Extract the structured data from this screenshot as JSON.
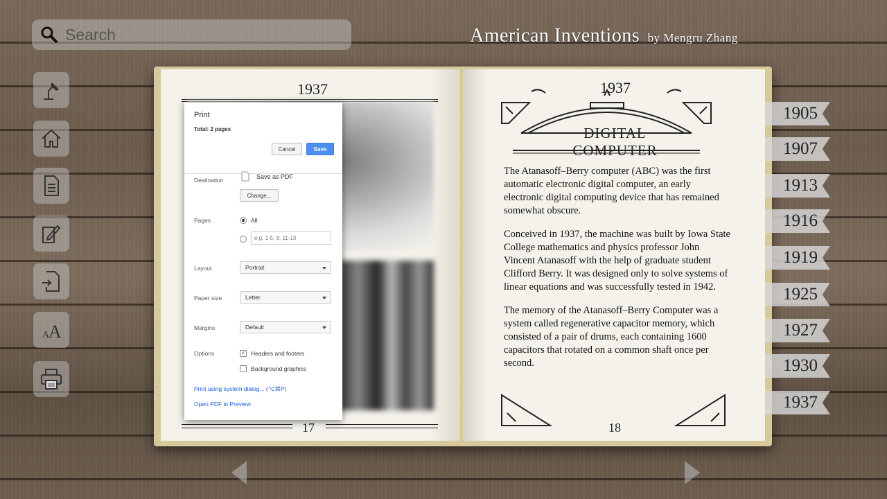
{
  "search": {
    "placeholder": "Search"
  },
  "header": {
    "title": "American Inventions",
    "byline": "by Mengru Zhang"
  },
  "toolbar": [
    "lamp-icon",
    "home-icon",
    "document-icon",
    "edit-note-icon",
    "import-icon",
    "font-size-icon",
    "print-icon"
  ],
  "book": {
    "left": {
      "year": "1937",
      "page_number": "17"
    },
    "right": {
      "year": "1937",
      "heading": "DIGITAL COMPUTER",
      "page_number": "18",
      "paragraphs": [
        "The Atanasoff–Berry computer (ABC) was the first automatic electronic digital computer, an early electronic digital computing device that has remained somewhat obscure.",
        "Conceived in 1937, the machine was built by Iowa State College mathematics and physics professor John Vincent Atanasoff with the help of graduate student Clifford Berry. It was designed only to solve systems of linear equations and was successfully tested in 1942.",
        "The memory of the Atanasoff–Berry Computer was a system called regenerative capacitor memory, which consisted of a pair of drums, each containing 1600 capacitors that rotated on a common shaft once per second."
      ]
    }
  },
  "print_dialog": {
    "title": "Print",
    "total": "Total: 2 pages",
    "cancel": "Cancel",
    "save": "Save",
    "destination_label": "Destination",
    "destination_value": "Save as PDF",
    "change": "Change...",
    "pages_label": "Pages",
    "pages_all": "All",
    "pages_placeholder": "e.g. 1-5, 8, 11-13",
    "layout_label": "Layout",
    "layout_value": "Portrait",
    "paper_label": "Paper size",
    "paper_value": "Letter",
    "margins_label": "Margins",
    "margins_value": "Default",
    "options_label": "Options",
    "opt_headers": "Headers and footers",
    "opt_background": "Background graphics",
    "system_dialog": "Print using system dialog... (⌥⌘P)",
    "open_preview": "Open PDF in Preview"
  },
  "year_tabs": [
    "1905",
    "1907",
    "1913",
    "1916",
    "1919",
    "1925",
    "1927",
    "1930",
    "1937"
  ]
}
